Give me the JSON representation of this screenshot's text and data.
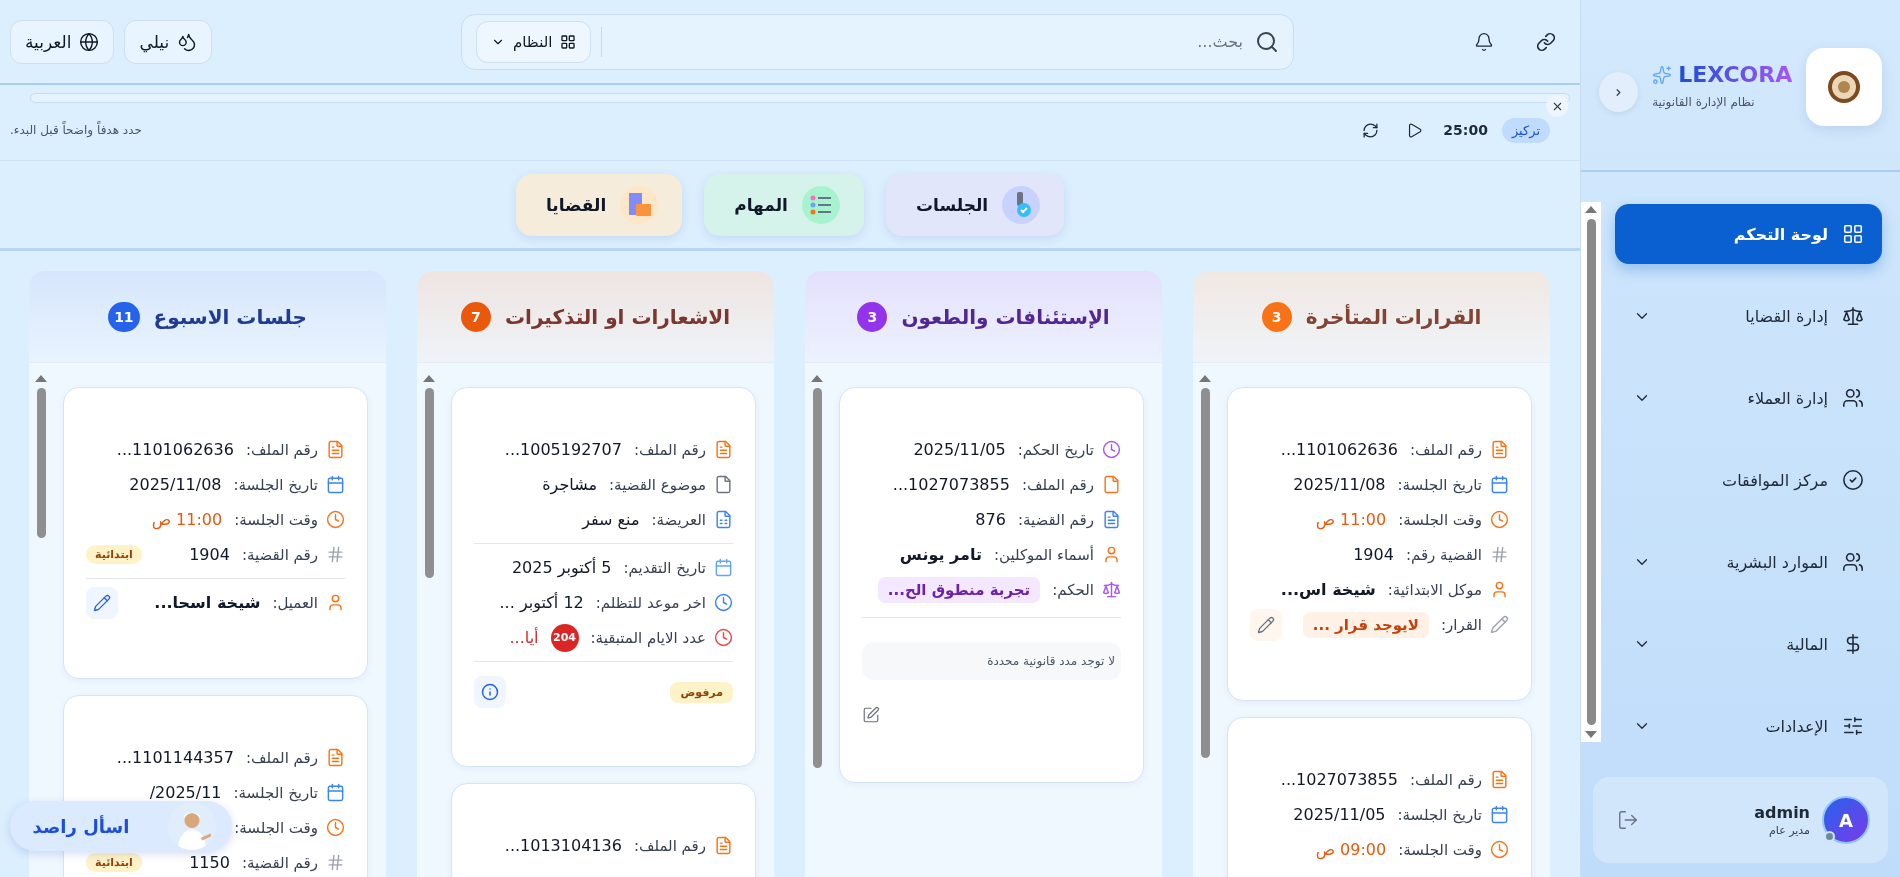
{
  "sidebar": {
    "brand": "LEXCORA",
    "subtitle": "نظام الإدارة القانونية",
    "items": [
      {
        "label": "لوحة التحكم",
        "kind": "dashboard",
        "selected": true,
        "expandable": false
      },
      {
        "label": "إدارة القضايا",
        "kind": "cases",
        "selected": false,
        "expandable": true
      },
      {
        "label": "إدارة العملاء",
        "kind": "clients",
        "selected": false,
        "expandable": true
      },
      {
        "label": "مركز الموافقات",
        "kind": "approvals",
        "selected": false,
        "expandable": false
      },
      {
        "label": "الموارد البشرية",
        "kind": "hr",
        "selected": false,
        "expandable": true
      },
      {
        "label": "المالية",
        "kind": "finance",
        "selected": false,
        "expandable": true
      },
      {
        "label": "الإعدادات",
        "kind": "settings",
        "selected": false,
        "expandable": true
      }
    ],
    "user": {
      "initial": "A",
      "name": "admin",
      "role": "مدير عام"
    }
  },
  "topbar": {
    "search": {
      "placeholder": "بحث..."
    },
    "system_menu": "النظام",
    "theme_button": "نيلي",
    "language_button": "العربية"
  },
  "focus": {
    "level": 0,
    "mode": "تركيز",
    "timer": "25:00",
    "hint": "حدد هدفاً واضحاً قبل البدء."
  },
  "tabs": [
    {
      "label": "الجلسات",
      "kind": "sessions",
      "color": "#e2e6fb"
    },
    {
      "label": "المهام",
      "kind": "tasks",
      "color": "#d5f3ea"
    },
    {
      "label": "القضايا",
      "kind": "cases",
      "color": "#f6ecdc"
    }
  ],
  "columns": [
    {
      "title": "القرارات المتأخرة",
      "count": "3",
      "color": "#f97316",
      "cards": [
        {
          "sections": [
            [
              {
                "kind": "file",
                "label": "رقم الملف:",
                "value": "1101062636..."
              },
              {
                "kind": "date",
                "label": "تاريخ الجلسة:",
                "value": "2025/11/08"
              },
              {
                "kind": "time",
                "label": "وقت الجلسة:",
                "value": "11:00 ص"
              },
              {
                "kind": "number",
                "label": "القضية رقم:",
                "value": "1904"
              },
              {
                "kind": "client",
                "label": "موكل الابتدائية:",
                "value": "شيخة اس..."
              },
              {
                "kind": "decision",
                "label": "القرار:",
                "value": "لايوجد قرار ..."
              }
            ]
          ]
        },
        {
          "sections": [
            [
              {
                "kind": "file",
                "label": "رقم الملف:",
                "value": "1027073855..."
              },
              {
                "kind": "date",
                "label": "تاريخ الجلسة:",
                "value": "2025/11/05"
              },
              {
                "kind": "time",
                "label": "وقت الجلسة:",
                "value": "09:00 ص"
              }
            ]
          ]
        }
      ]
    },
    {
      "title": "الإستئنافات والطعون",
      "count": "3",
      "color": "#9333ea",
      "cards": [
        {
          "sections": [
            [
              {
                "kind": "verdict-date",
                "label": "تاريخ الحكم:",
                "value": "2025/11/05"
              },
              {
                "kind": "file-plain",
                "label": "رقم الملف:",
                "value": "1027073855..."
              },
              {
                "kind": "doc",
                "label": "رقم القضية:",
                "value": "876"
              },
              {
                "kind": "client",
                "label": "أسماء الموكلين:",
                "value": "تامر يونس"
              },
              {
                "kind": "verdict",
                "label": "الحكم:",
                "value": "تجربة منطوق الح..."
              }
            ]
          ],
          "note": "لا توجد مدد قانونية محددة"
        }
      ]
    },
    {
      "title": "الاشعارات او التذكيرات",
      "count": "7",
      "color": "#ea580c",
      "cards": [
        {
          "sections": [
            [
              {
                "kind": "file",
                "label": "رقم الملف:",
                "value": "1005192707..."
              },
              {
                "kind": "subject",
                "label": "موضوع القضية:",
                "value": "مشاجرة"
              },
              {
                "kind": "petition",
                "label": "العريضة:",
                "value": "منع سفر"
              }
            ],
            [
              {
                "kind": "submitted",
                "label": "تاريخ التقديم:",
                "value": "5 أكتوبر 2025"
              },
              {
                "kind": "deadline",
                "label": "اخر موعد للتظلم:",
                "value": "12 أكتوبر ..."
              },
              {
                "kind": "remaining",
                "label": "عدد الايام المتبقية:",
                "count": "204",
                "value": "أيا..."
              }
            ]
          ],
          "status": "مرفوض"
        },
        {
          "sections": [
            [
              {
                "kind": "file",
                "label": "رقم الملف:",
                "value": "1013104136..."
              }
            ]
          ]
        }
      ]
    },
    {
      "title": "جلسات الاسبوع",
      "count": "11",
      "color": "#2563eb",
      "cards": [
        {
          "sections": [
            [
              {
                "kind": "file",
                "label": "رقم الملف:",
                "value": "1101062636..."
              },
              {
                "kind": "date",
                "label": "تاريخ الجلسة:",
                "value": "2025/11/08"
              },
              {
                "kind": "time",
                "label": "وقت الجلسة:",
                "value": "11:00 ص"
              },
              {
                "kind": "number",
                "label": "رقم القضية:",
                "value": "1904",
                "tag": "ابتدائية"
              }
            ],
            [
              {
                "kind": "client-edit",
                "label": "العميل:",
                "value": "شيخة اسحا..."
              }
            ]
          ]
        },
        {
          "sections": [
            [
              {
                "kind": "file",
                "label": "رقم الملف:",
                "value": "1101144357..."
              },
              {
                "kind": "date",
                "label": "تاريخ الجلسة:",
                "value": "2025/11/"
              },
              {
                "kind": "time",
                "label": "وقت الجلسة:"
              },
              {
                "kind": "number",
                "label": "رقم القضية:",
                "value": "1150",
                "tag": "ابتدائية"
              }
            ]
          ]
        }
      ]
    }
  ],
  "assistant": {
    "label": "اسأل راصد"
  }
}
